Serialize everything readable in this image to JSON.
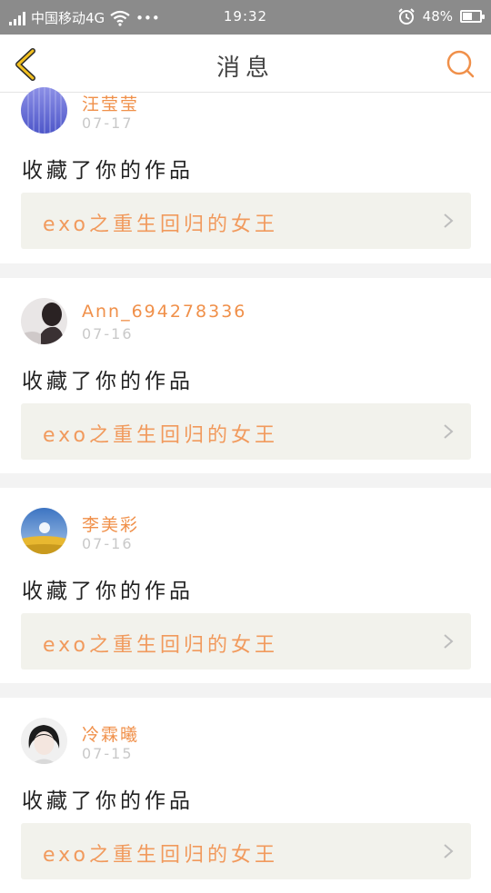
{
  "status_bar": {
    "carrier": "中国移动4G",
    "dots": "•••",
    "time": "19:32",
    "battery": "48%",
    "battery_level": 0.48,
    "icons": [
      "signal-icon",
      "wifi-icon",
      "alarm-icon",
      "battery-icon"
    ]
  },
  "header": {
    "title": "消息",
    "back_icon": "chevron-left-icon",
    "search_icon": "search-icon",
    "accent": "#f0904a"
  },
  "messages": [
    {
      "username": "汪莹莹",
      "date": "07-17",
      "action": "收藏了你的作品",
      "work_title": "exo之重生回归的女王"
    },
    {
      "username": "Ann_694278336",
      "date": "07-16",
      "action": "收藏了你的作品",
      "work_title": "exo之重生回归的女王"
    },
    {
      "username": "李美彩",
      "date": "07-16",
      "action": "收藏了你的作品",
      "work_title": "exo之重生回归的女王"
    },
    {
      "username": "冷霖曦",
      "date": "07-15",
      "action": "收藏了你的作品",
      "work_title": "exo之重生回归的女王"
    }
  ]
}
